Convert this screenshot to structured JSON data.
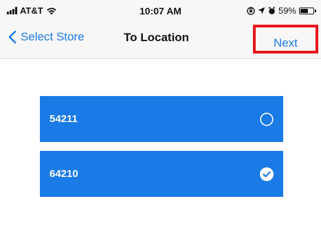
{
  "status_bar": {
    "carrier": "AT&T",
    "time": "10:07 AM",
    "battery_text": "59%",
    "battery_level": 0.59
  },
  "nav": {
    "back_label": "Select Store",
    "title": "To Location",
    "next_label": "Next"
  },
  "stores": [
    {
      "label": "54211",
      "selected": false
    },
    {
      "label": "64210",
      "selected": true
    }
  ],
  "colors": {
    "accent": "#1a7ae6",
    "highlight_border": "#e8141b"
  }
}
